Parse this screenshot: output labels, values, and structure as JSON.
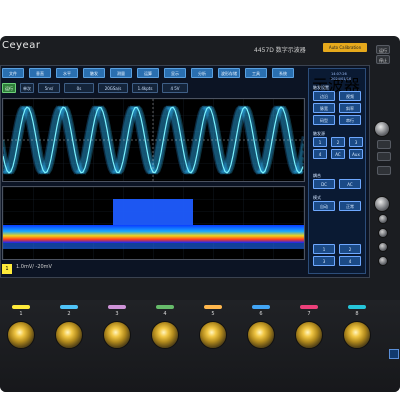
{
  "brand": "Ceyear",
  "model": "4457D 数字示波器",
  "status_badge": "Auto Calibration",
  "top_right": {
    "btn1": "运行",
    "btn2": "停止"
  },
  "menu": [
    "文件",
    "垂直",
    "水平",
    "触发",
    "测量",
    "运算",
    "显示",
    "分析",
    "波形存储",
    "工具",
    "系统"
  ],
  "controls": [
    {
      "label": "运行",
      "active": true
    },
    {
      "label": "单次",
      "active": false
    },
    {
      "label": "5ns/",
      "active": false
    },
    {
      "label": "0s",
      "active": false
    },
    {
      "label": "20GSa/s",
      "active": false
    },
    {
      "label": "1.4kpts",
      "active": false
    },
    {
      "label": "4 5V",
      "active": false
    }
  ],
  "bottom_info": {
    "ch_badge": "1",
    "text": "1.0mV/  -20mV"
  },
  "panel": {
    "title": "示波器",
    "time_small": "14:07:26",
    "date_small": "2024/01/16",
    "section1": "触发设置",
    "section1_opts": [
      "边沿",
      "视频",
      "脉宽",
      "斜率",
      "码型",
      "串行"
    ],
    "section2": "触发源",
    "section2_opts": [
      "1",
      "2",
      "3",
      "4",
      "AC",
      "Aux"
    ],
    "section3": "耦合",
    "section3_opts": [
      "DC",
      "AC"
    ],
    "section4": "模式",
    "section4_opts": [
      "自动",
      "正常"
    ],
    "bottom_opts": [
      "1",
      "2",
      "3",
      "4"
    ]
  },
  "channels": [
    {
      "num": "1",
      "color": "#ffeb3b"
    },
    {
      "num": "2",
      "color": "#4fc3f7"
    },
    {
      "num": "3",
      "color": "#ce93d8"
    },
    {
      "num": "4",
      "color": "#66bb6a"
    },
    {
      "num": "5",
      "color": "#ffb74d"
    },
    {
      "num": "6",
      "color": "#42a5f5"
    },
    {
      "num": "7",
      "color": "#ec407a"
    },
    {
      "num": "8",
      "color": "#26c6da"
    }
  ]
}
